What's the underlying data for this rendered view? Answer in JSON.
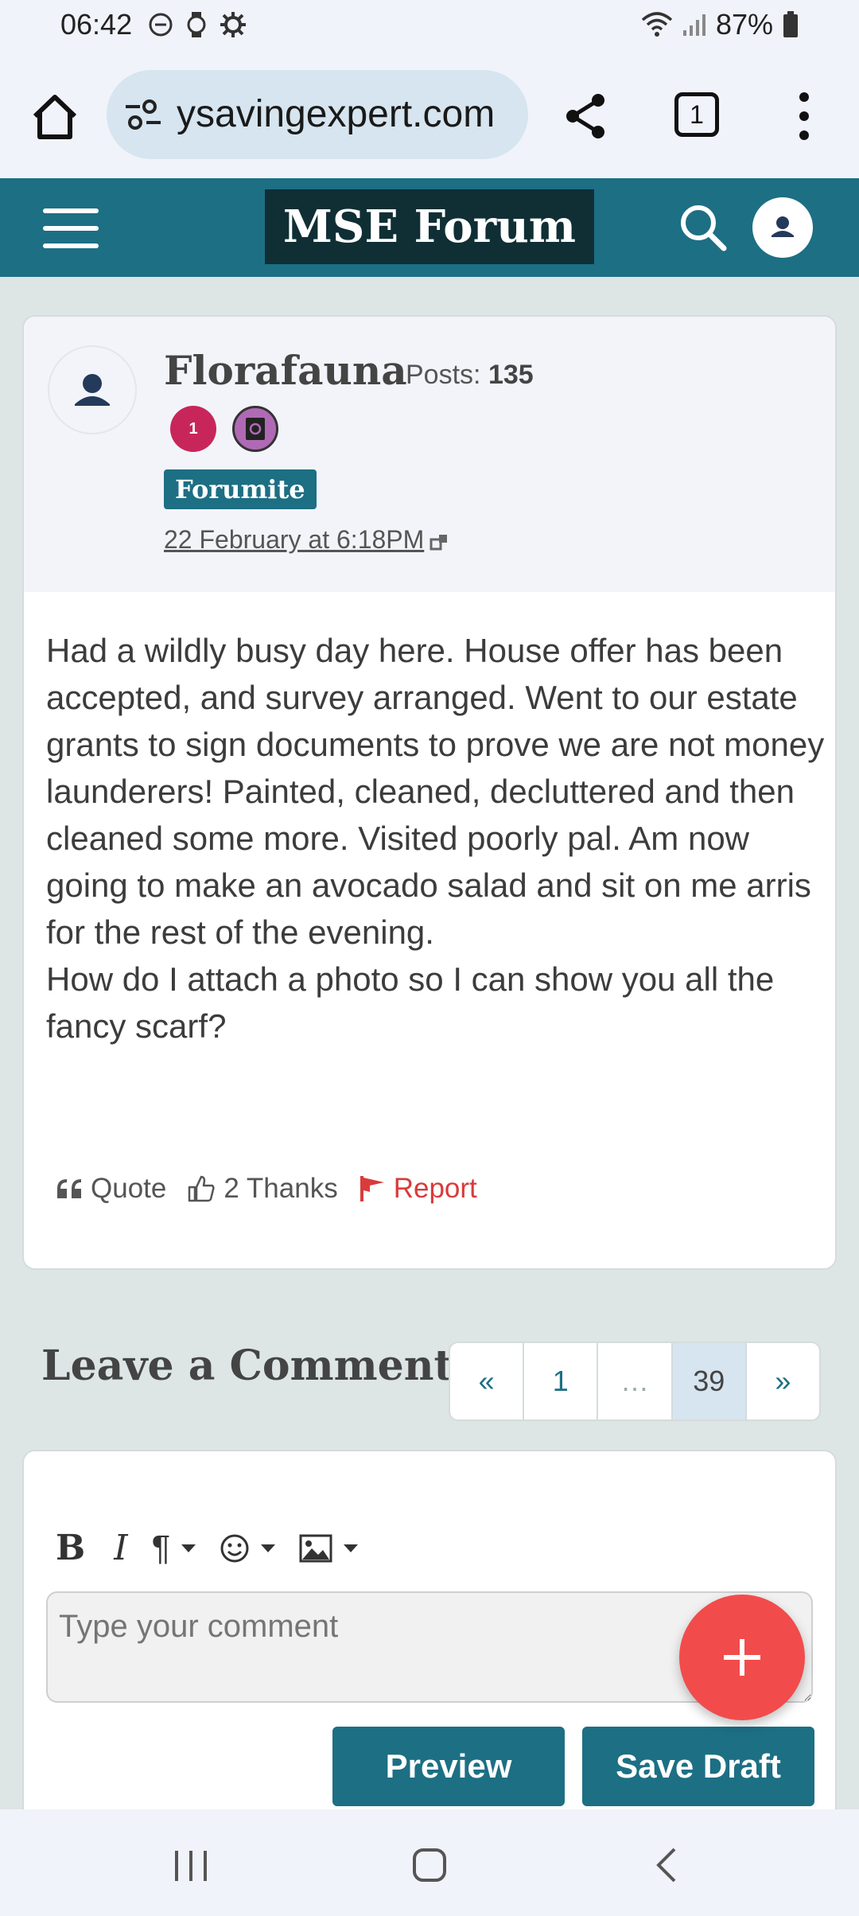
{
  "status_bar": {
    "time": "06:42",
    "battery": "87%"
  },
  "browser": {
    "url": "ysavingexpert.com",
    "tab_count": "1"
  },
  "site": {
    "logo": "MSE Forum"
  },
  "post": {
    "author": "Florafauna",
    "posts_label": "Posts:",
    "posts_count": "135",
    "badge_number": "1",
    "rank": "Forumite",
    "date": "22 February at 6:18PM",
    "body": [
      "Had a wildly busy day here. House offer has been accepted, and survey arranged. Went to our estate grants to sign documents to prove we are not money launderers! Painted, cleaned, decluttered and then cleaned some more. Visited poorly pal. Am now going to make an avocado salad and sit on me arris for the rest of the evening.",
      "How do I attach a photo so I can show you all the fancy scarf?"
    ],
    "actions": {
      "quote": "Quote",
      "thanks": "2 Thanks",
      "report": "Report"
    }
  },
  "comment": {
    "heading": "Leave a Comment",
    "pager": {
      "prev": "«",
      "first": "1",
      "ellipsis": "…",
      "current": "39",
      "next": "»"
    },
    "toolbar": {
      "bold": "B",
      "italic": "I",
      "paragraph": "¶"
    },
    "placeholder": "Type your comment",
    "preview_label": "Preview",
    "save_draft_label": "Save Draft"
  },
  "colors": {
    "brand": "#1d6f84",
    "logo_bg": "#0f2f35",
    "report": "#d93b3b",
    "fab": "#f24b4b"
  }
}
